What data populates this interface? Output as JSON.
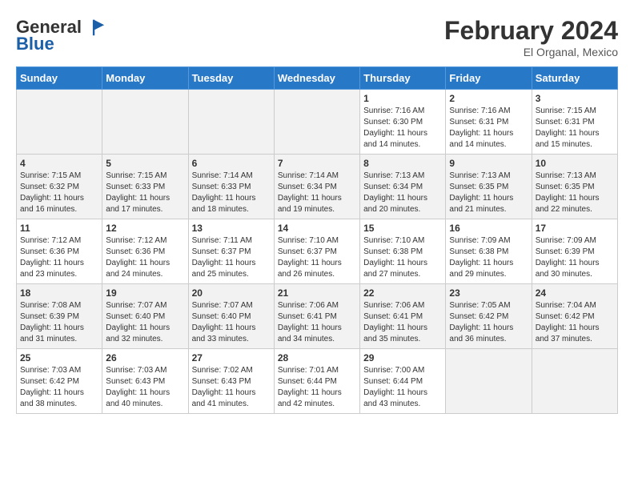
{
  "header": {
    "logo_general": "General",
    "logo_blue": "Blue",
    "month_title": "February 2024",
    "location": "El Organal, Mexico"
  },
  "calendar": {
    "days_of_week": [
      "Sunday",
      "Monday",
      "Tuesday",
      "Wednesday",
      "Thursday",
      "Friday",
      "Saturday"
    ],
    "weeks": [
      [
        {
          "day": "",
          "sunrise": "",
          "sunset": "",
          "daylight": ""
        },
        {
          "day": "",
          "sunrise": "",
          "sunset": "",
          "daylight": ""
        },
        {
          "day": "",
          "sunrise": "",
          "sunset": "",
          "daylight": ""
        },
        {
          "day": "",
          "sunrise": "",
          "sunset": "",
          "daylight": ""
        },
        {
          "day": "1",
          "sunrise": "Sunrise: 7:16 AM",
          "sunset": "Sunset: 6:30 PM",
          "daylight": "Daylight: 11 hours and 14 minutes."
        },
        {
          "day": "2",
          "sunrise": "Sunrise: 7:16 AM",
          "sunset": "Sunset: 6:31 PM",
          "daylight": "Daylight: 11 hours and 14 minutes."
        },
        {
          "day": "3",
          "sunrise": "Sunrise: 7:15 AM",
          "sunset": "Sunset: 6:31 PM",
          "daylight": "Daylight: 11 hours and 15 minutes."
        }
      ],
      [
        {
          "day": "4",
          "sunrise": "Sunrise: 7:15 AM",
          "sunset": "Sunset: 6:32 PM",
          "daylight": "Daylight: 11 hours and 16 minutes."
        },
        {
          "day": "5",
          "sunrise": "Sunrise: 7:15 AM",
          "sunset": "Sunset: 6:33 PM",
          "daylight": "Daylight: 11 hours and 17 minutes."
        },
        {
          "day": "6",
          "sunrise": "Sunrise: 7:14 AM",
          "sunset": "Sunset: 6:33 PM",
          "daylight": "Daylight: 11 hours and 18 minutes."
        },
        {
          "day": "7",
          "sunrise": "Sunrise: 7:14 AM",
          "sunset": "Sunset: 6:34 PM",
          "daylight": "Daylight: 11 hours and 19 minutes."
        },
        {
          "day": "8",
          "sunrise": "Sunrise: 7:13 AM",
          "sunset": "Sunset: 6:34 PM",
          "daylight": "Daylight: 11 hours and 20 minutes."
        },
        {
          "day": "9",
          "sunrise": "Sunrise: 7:13 AM",
          "sunset": "Sunset: 6:35 PM",
          "daylight": "Daylight: 11 hours and 21 minutes."
        },
        {
          "day": "10",
          "sunrise": "Sunrise: 7:13 AM",
          "sunset": "Sunset: 6:35 PM",
          "daylight": "Daylight: 11 hours and 22 minutes."
        }
      ],
      [
        {
          "day": "11",
          "sunrise": "Sunrise: 7:12 AM",
          "sunset": "Sunset: 6:36 PM",
          "daylight": "Daylight: 11 hours and 23 minutes."
        },
        {
          "day": "12",
          "sunrise": "Sunrise: 7:12 AM",
          "sunset": "Sunset: 6:36 PM",
          "daylight": "Daylight: 11 hours and 24 minutes."
        },
        {
          "day": "13",
          "sunrise": "Sunrise: 7:11 AM",
          "sunset": "Sunset: 6:37 PM",
          "daylight": "Daylight: 11 hours and 25 minutes."
        },
        {
          "day": "14",
          "sunrise": "Sunrise: 7:10 AM",
          "sunset": "Sunset: 6:37 PM",
          "daylight": "Daylight: 11 hours and 26 minutes."
        },
        {
          "day": "15",
          "sunrise": "Sunrise: 7:10 AM",
          "sunset": "Sunset: 6:38 PM",
          "daylight": "Daylight: 11 hours and 27 minutes."
        },
        {
          "day": "16",
          "sunrise": "Sunrise: 7:09 AM",
          "sunset": "Sunset: 6:38 PM",
          "daylight": "Daylight: 11 hours and 29 minutes."
        },
        {
          "day": "17",
          "sunrise": "Sunrise: 7:09 AM",
          "sunset": "Sunset: 6:39 PM",
          "daylight": "Daylight: 11 hours and 30 minutes."
        }
      ],
      [
        {
          "day": "18",
          "sunrise": "Sunrise: 7:08 AM",
          "sunset": "Sunset: 6:39 PM",
          "daylight": "Daylight: 11 hours and 31 minutes."
        },
        {
          "day": "19",
          "sunrise": "Sunrise: 7:07 AM",
          "sunset": "Sunset: 6:40 PM",
          "daylight": "Daylight: 11 hours and 32 minutes."
        },
        {
          "day": "20",
          "sunrise": "Sunrise: 7:07 AM",
          "sunset": "Sunset: 6:40 PM",
          "daylight": "Daylight: 11 hours and 33 minutes."
        },
        {
          "day": "21",
          "sunrise": "Sunrise: 7:06 AM",
          "sunset": "Sunset: 6:41 PM",
          "daylight": "Daylight: 11 hours and 34 minutes."
        },
        {
          "day": "22",
          "sunrise": "Sunrise: 7:06 AM",
          "sunset": "Sunset: 6:41 PM",
          "daylight": "Daylight: 11 hours and 35 minutes."
        },
        {
          "day": "23",
          "sunrise": "Sunrise: 7:05 AM",
          "sunset": "Sunset: 6:42 PM",
          "daylight": "Daylight: 11 hours and 36 minutes."
        },
        {
          "day": "24",
          "sunrise": "Sunrise: 7:04 AM",
          "sunset": "Sunset: 6:42 PM",
          "daylight": "Daylight: 11 hours and 37 minutes."
        }
      ],
      [
        {
          "day": "25",
          "sunrise": "Sunrise: 7:03 AM",
          "sunset": "Sunset: 6:42 PM",
          "daylight": "Daylight: 11 hours and 38 minutes."
        },
        {
          "day": "26",
          "sunrise": "Sunrise: 7:03 AM",
          "sunset": "Sunset: 6:43 PM",
          "daylight": "Daylight: 11 hours and 40 minutes."
        },
        {
          "day": "27",
          "sunrise": "Sunrise: 7:02 AM",
          "sunset": "Sunset: 6:43 PM",
          "daylight": "Daylight: 11 hours and 41 minutes."
        },
        {
          "day": "28",
          "sunrise": "Sunrise: 7:01 AM",
          "sunset": "Sunset: 6:44 PM",
          "daylight": "Daylight: 11 hours and 42 minutes."
        },
        {
          "day": "29",
          "sunrise": "Sunrise: 7:00 AM",
          "sunset": "Sunset: 6:44 PM",
          "daylight": "Daylight: 11 hours and 43 minutes."
        },
        {
          "day": "",
          "sunrise": "",
          "sunset": "",
          "daylight": ""
        },
        {
          "day": "",
          "sunrise": "",
          "sunset": "",
          "daylight": ""
        }
      ]
    ]
  }
}
